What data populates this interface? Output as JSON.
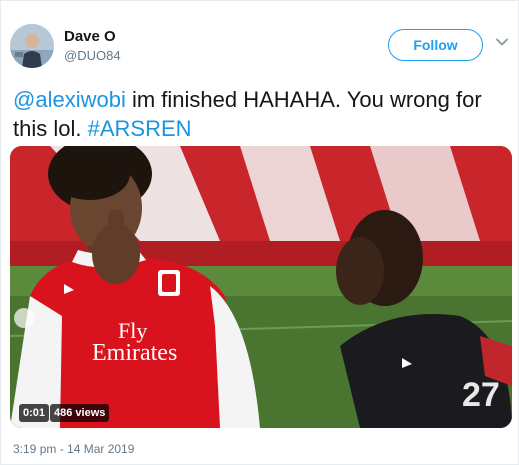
{
  "user": {
    "display_name": "Dave O",
    "handle": "@DUO84"
  },
  "follow_button": {
    "label": "Follow"
  },
  "tweet": {
    "mention": "@alexiwobi",
    "text": " im finished HAHAHA. You wrong for this lol. ",
    "hashtag": "#ARSREN"
  },
  "video": {
    "elapsed": "0:01",
    "views": "486 views",
    "kit_sponsor_line1": "Fly",
    "kit_sponsor_line2": "Emirates",
    "opponent_number": "27"
  },
  "timestamp": "3:19 pm - 14 Mar 2019",
  "colors": {
    "accent": "#1da1f2",
    "link": "#1b95e0",
    "muted": "#657786",
    "arsenal_red": "#d9131d",
    "pitch_green": "#4f7a33"
  }
}
